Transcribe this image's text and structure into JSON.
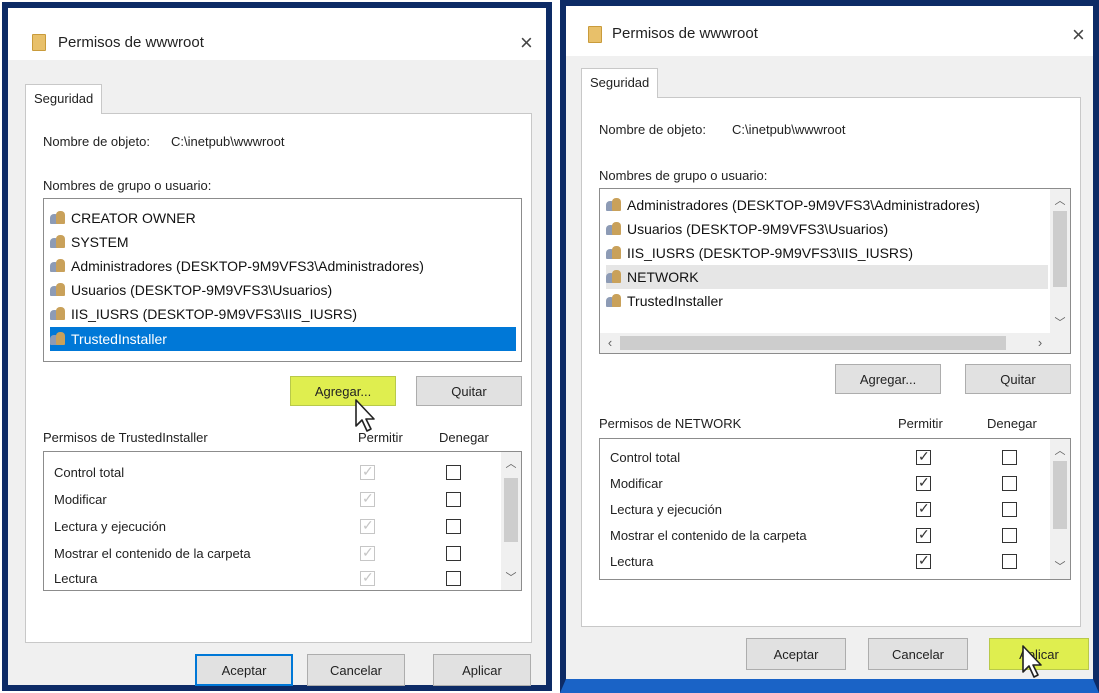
{
  "left": {
    "title": "Permisos de wwwroot",
    "close": "×",
    "tab": "Seguridad",
    "object_label": "Nombre de objeto:",
    "object_value": "C:\\inetpub\\wwwroot",
    "group_label": "Nombres de grupo o usuario:",
    "users": [
      "CREATOR OWNER",
      "SYSTEM",
      "Administradores (DESKTOP-9M9VFS3\\Administradores)",
      "Usuarios (DESKTOP-9M9VFS3\\Usuarios)",
      "IIS_IUSRS (DESKTOP-9M9VFS3\\IIS_IUSRS)",
      "TrustedInstaller"
    ],
    "selected_user": "TrustedInstaller",
    "add_button": "Agregar...",
    "remove_button": "Quitar",
    "perms_label": "Permisos de TrustedInstaller",
    "allow_header": "Permitir",
    "deny_header": "Denegar",
    "permissions": [
      {
        "name": "Control total",
        "allow": true,
        "deny": false
      },
      {
        "name": "Modificar",
        "allow": true,
        "deny": false
      },
      {
        "name": "Lectura y ejecución",
        "allow": true,
        "deny": false
      },
      {
        "name": "Mostrar el contenido de la carpeta",
        "allow": true,
        "deny": false
      },
      {
        "name": "Lectura",
        "allow": true,
        "deny": false
      }
    ],
    "ok_button": "Aceptar",
    "cancel_button": "Cancelar",
    "apply_button": "Aplicar"
  },
  "right": {
    "title": "Permisos de wwwroot",
    "close": "×",
    "tab": "Seguridad",
    "object_label": "Nombre de objeto:",
    "object_value": "C:\\inetpub\\wwwroot",
    "group_label": "Nombres de grupo o usuario:",
    "users": [
      "Administradores (DESKTOP-9M9VFS3\\Administradores)",
      "Usuarios (DESKTOP-9M9VFS3\\Usuarios)",
      "IIS_IUSRS (DESKTOP-9M9VFS3\\IIS_IUSRS)",
      "NETWORK",
      "TrustedInstaller"
    ],
    "selected_user": "NETWORK",
    "add_button": "Agregar...",
    "remove_button": "Quitar",
    "perms_label": "Permisos de NETWORK",
    "allow_header": "Permitir",
    "deny_header": "Denegar",
    "permissions": [
      {
        "name": "Control total",
        "allow": true,
        "deny": false
      },
      {
        "name": "Modificar",
        "allow": true,
        "deny": false
      },
      {
        "name": "Lectura y ejecución",
        "allow": true,
        "deny": false
      },
      {
        "name": "Mostrar el contenido de la carpeta",
        "allow": true,
        "deny": false
      },
      {
        "name": "Lectura",
        "allow": true,
        "deny": false
      }
    ],
    "ok_button": "Aceptar",
    "cancel_button": "Cancelar",
    "apply_button": "Aplicar"
  },
  "icons": {
    "folder": "folder-icon",
    "users": "users-icon",
    "cursor": "mouse-pointer-icon"
  },
  "colors": {
    "frame": "#0d2b66",
    "highlight": "#dfee4f",
    "selection": "#0078d7",
    "taskbar": "#1a63c6"
  }
}
